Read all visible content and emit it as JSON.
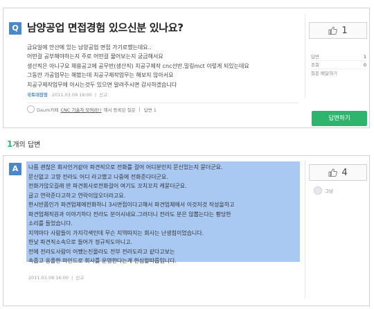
{
  "question": {
    "badge": "Q",
    "title": "남양공업 면접경험 있으신분 있나요?",
    "lines": [
      "금요일에 안산에 있는 남양공업 면접 가기로했는데요..",
      "어떤걸 공부해야하는지 주로 어떤걸 물어보는지 궁금해서요",
      "생산직은 아니구요 채용공고에 공무반(생산직) 치공구제작 cnc선반.밀링mct 이렇게 되있는데요",
      "그동안 가공업무는 해봤는데 치공구제작업무는 해보지 않아서요",
      "치공구제작업무에 아시는것두 있으면 알려주시면 감사하겠습니다"
    ],
    "category": "국토대장정",
    "date": "2011.03.09 16:00",
    "report": "신고",
    "source_prefix": "Daum카페",
    "source_link": "CNC 기술자 모여라!!",
    "source_suffix": "에서 등록된 질문",
    "source_answers": "답변 1",
    "likes": "1",
    "stats": [
      {
        "label": "답변",
        "value": "1"
      },
      {
        "label": "조회",
        "value": "0"
      },
      {
        "label": "질문 배달하기",
        "value": ""
      }
    ],
    "answer_button": "답변하기"
  },
  "answer_count": {
    "number": "1",
    "label": "개의 답변"
  },
  "answer": {
    "badge": "A",
    "lines": [
      "나름 괜찮은 회사인거같아 파견직으로 전화를 걸어 어디분인지 문신있는지 묻더군요.",
      "문신없고 고향 전라도 어디 라고했고 나중에 전화준다더군요.",
      "전화가않오길래 딴 파견회사로전화걸어 여기도 꼬치꼬치 캐묻더군요.",
      "글고 연락준다고하고 연락이않오더라고요.",
      "한시반쯤인가 파견업체에전화하니 3시면접이다고해서 파견업체에서 이것저것 작성을하고",
      "파견업체직원과 이야기하다 전라도 분이시네요.그러더니 전라도 분은 않뽑는다는 황당한",
      "소리를 들었습니다.",
      "지역마다 사람들이 가지각색인데 무슨 지역따지는 회사는 난생첨이었습니다.",
      "한낮 파견직소속으로 들어가 정규직도아니고.",
      "전에 전라도사람이 어쨌는진몰라도 전부 전라도라고 같다고보는",
      "속좁고 옹졸한 마인드로 회사를 운영한다는게 한심할따릅입니다."
    ],
    "date": "2011.03.09 16:00",
    "report": "신고",
    "likes": "4",
    "user": "그냥"
  }
}
